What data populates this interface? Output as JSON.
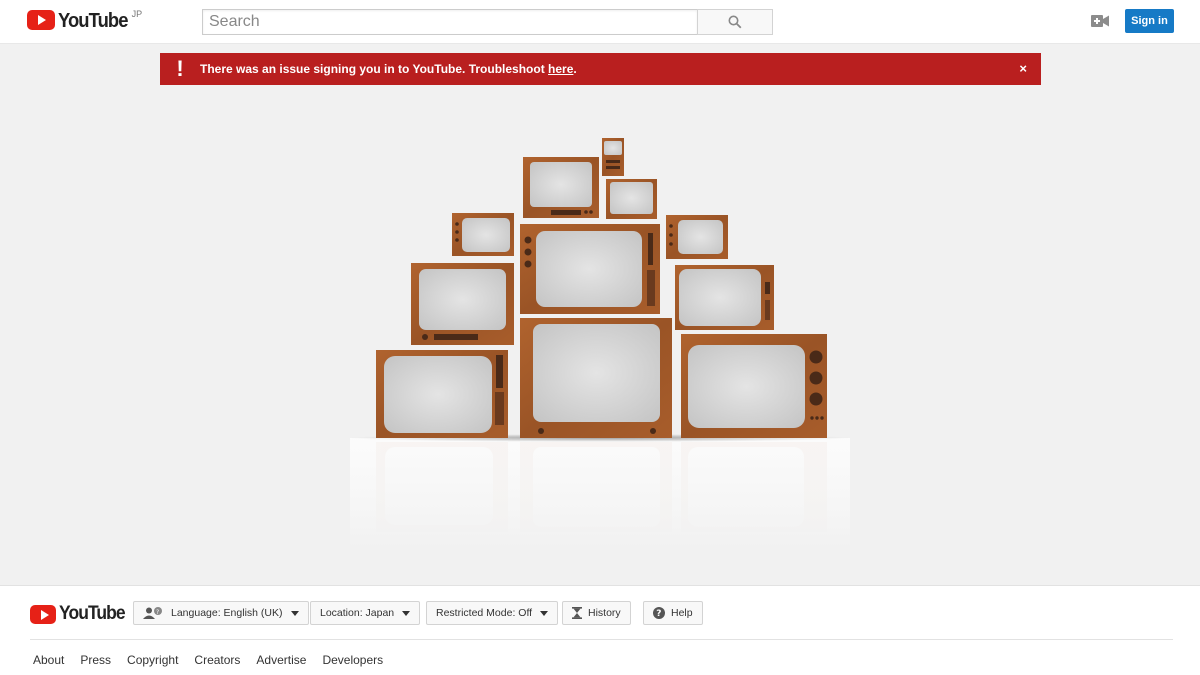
{
  "header": {
    "logo_text": "YouTube",
    "logo_region": "JP",
    "search_placeholder": "Search",
    "signin_label": "Sign in",
    "upload_icon": "video-camera-add-icon",
    "search_icon": "magnifier-icon"
  },
  "alert": {
    "message": "There was an issue signing you in to YouTube. Troubleshoot ",
    "link_text": "here",
    "link_suffix": ".",
    "close_label": "×",
    "icon": "exclamation-icon",
    "color": "#b91f1f"
  },
  "footer": {
    "logo_text": "YouTube",
    "language_label": "Language: English (UK)",
    "location_label": "Location: Japan",
    "restricted_label": "Restricted Mode: Off",
    "history_label": "History",
    "help_label": "Help",
    "links": [
      "About",
      "Press",
      "Copyright",
      "Creators",
      "Advertise",
      "Developers"
    ]
  },
  "colors": {
    "brand_red": "#e62117",
    "signin_blue": "#167ac6",
    "tv_wood": "#a0572a"
  }
}
